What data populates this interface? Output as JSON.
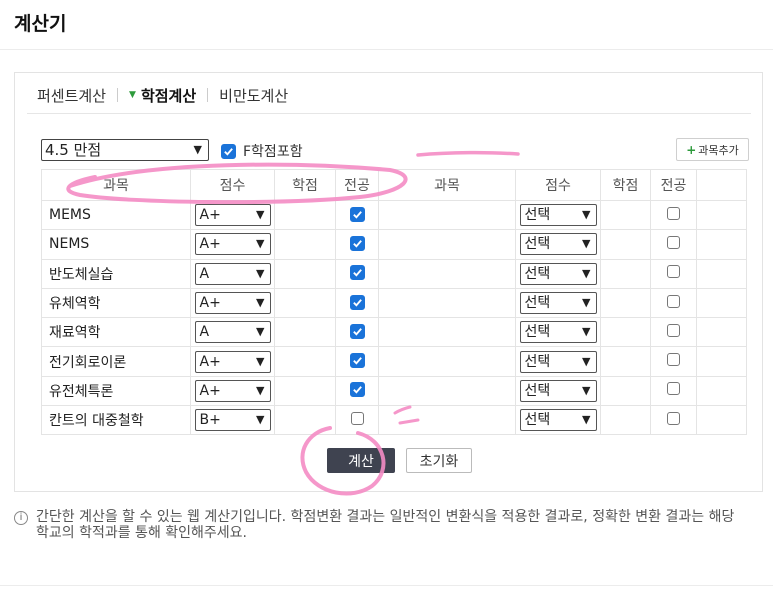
{
  "app": {
    "title": "계산기"
  },
  "tabs": [
    {
      "label": "퍼센트계산",
      "active": false
    },
    {
      "label": "학점계산",
      "active": true
    },
    {
      "label": "비만도계산",
      "active": false
    }
  ],
  "controls": {
    "scale_value": "4.5 만점",
    "f_include_label": "F학점포함",
    "f_include_checked": true,
    "add_course_label": "과목추가"
  },
  "table": {
    "headers": [
      "과목",
      "점수",
      "학점",
      "전공",
      "과목",
      "점수",
      "학점",
      "전공"
    ],
    "left_rows": [
      {
        "name": "MEMS",
        "grade": "A+",
        "credit": "",
        "major": true
      },
      {
        "name": "NEMS",
        "grade": "A+",
        "credit": "",
        "major": true
      },
      {
        "name": "반도체실습",
        "grade": "A",
        "credit": "",
        "major": true
      },
      {
        "name": "유체역학",
        "grade": "A+",
        "credit": "",
        "major": true
      },
      {
        "name": "재료역학",
        "grade": "A",
        "credit": "",
        "major": true
      },
      {
        "name": "전기회로이론",
        "grade": "A+",
        "credit": "",
        "major": true
      },
      {
        "name": "유전체특론",
        "grade": "A+",
        "credit": "",
        "major": true
      },
      {
        "name": "칸트의 대중철학",
        "grade": "B+",
        "credit": "",
        "major": false
      }
    ],
    "right_rows": [
      {
        "name": "",
        "grade": "선택",
        "credit": "",
        "major": false
      },
      {
        "name": "",
        "grade": "선택",
        "credit": "",
        "major": false
      },
      {
        "name": "",
        "grade": "선택",
        "credit": "",
        "major": false
      },
      {
        "name": "",
        "grade": "선택",
        "credit": "",
        "major": false
      },
      {
        "name": "",
        "grade": "선택",
        "credit": "",
        "major": false
      },
      {
        "name": "",
        "grade": "선택",
        "credit": "",
        "major": false
      },
      {
        "name": "",
        "grade": "선택",
        "credit": "",
        "major": false
      },
      {
        "name": "",
        "grade": "선택",
        "credit": "",
        "major": false
      }
    ]
  },
  "buttons": {
    "calc": "계산",
    "reset": "초기화"
  },
  "notice": {
    "line1": "간단한 계산을 할 수 있는 웹 계산기입니다. 학점변환 결과는 일반적인 변환식을 적용한 결과로, 정확한 변환 결과는 해당",
    "line2": "학교의 학적과를 통해 확인해주세요."
  },
  "colors": {
    "accent_blue": "#1a73d9",
    "annotation_pink": "#f48cc4",
    "calc_button": "#3f4350",
    "tab_arrow": "#2e9b3c"
  }
}
